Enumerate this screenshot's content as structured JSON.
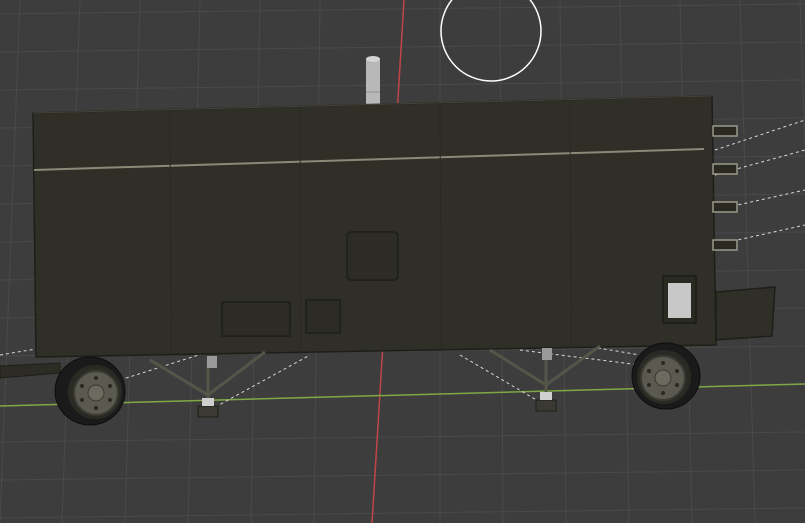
{
  "viewport": {
    "view": "3D Viewport",
    "object": "trailer",
    "colors": {
      "background": "#3d3d3d",
      "grid": "#4a4a4a",
      "x_axis": "#7fa845",
      "y_axis": "#c0454a",
      "body": "#2f2f27",
      "body_edge": "#1e1e19",
      "body_trim": "#8a8a78",
      "wheel_tire": "#1a1a1a",
      "wheel_rim": "#5a5a50",
      "cursor": "#ffffff",
      "exhaust": "#b8b8b8",
      "window": "#c8c8c8"
    }
  }
}
